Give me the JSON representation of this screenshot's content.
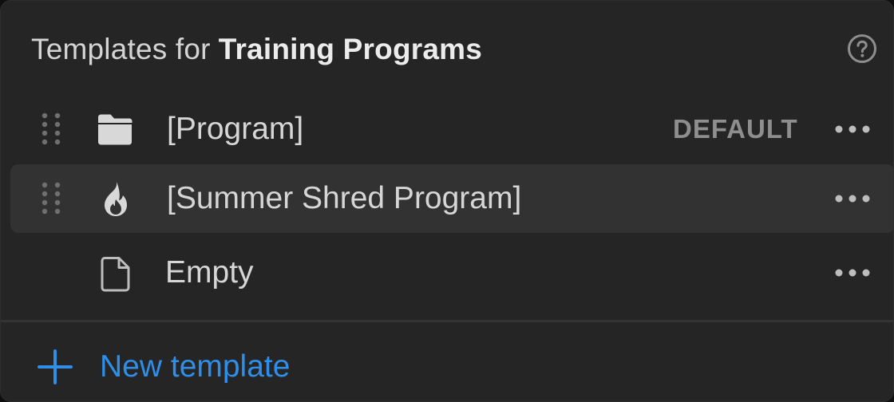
{
  "header": {
    "prefix": "Templates for",
    "database_name": "Training Programs"
  },
  "icons": {
    "help": "question-circle-icon",
    "drag": "drag-handle-icon",
    "more": "ellipsis-icon",
    "add": "plus-icon"
  },
  "templates": [
    {
      "label": "[Program]",
      "icon": "folder-icon",
      "badge": "DEFAULT"
    },
    {
      "label": "[Summer Shred Program]",
      "icon": "flame-icon",
      "badge": ""
    },
    {
      "label": "Empty",
      "icon": "page-icon",
      "badge": ""
    }
  ],
  "footer": {
    "new_template_label": "New template"
  },
  "colors": {
    "accent": "#2e8ee8",
    "panel_bg": "#252525",
    "selected_row_bg": "#323232",
    "text": "#d6d6d6",
    "muted": "#8e8e8e"
  }
}
